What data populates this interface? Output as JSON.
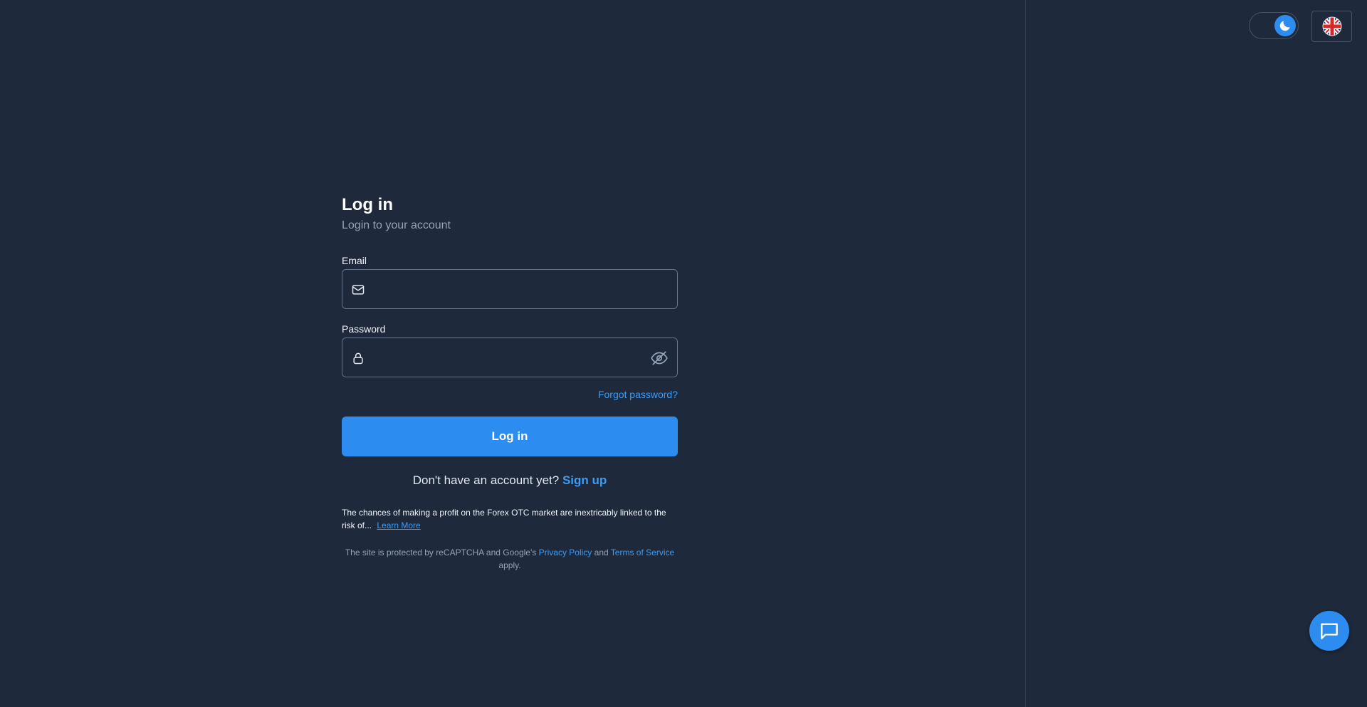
{
  "header": {
    "theme_toggle_icon": "moon-icon",
    "language_icon": "uk-flag-icon"
  },
  "login": {
    "title": "Log in",
    "subtitle": "Login to your account",
    "email_label": "Email",
    "email_value": "",
    "email_placeholder": "",
    "password_label": "Password",
    "password_value": "",
    "password_placeholder": "",
    "forgot_link": "Forgot password?",
    "submit_label": "Log in",
    "signup_prompt": "Don't have an account yet?",
    "signup_link": "Sign up",
    "risk_text": "The chances of making a profit on the Forex OTC market are inextricably linked to the risk of...",
    "risk_link": "Learn More",
    "recaptcha_prefix": "The site is protected by reCAPTCHA and Google's",
    "privacy_link": "Privacy Policy",
    "recaptcha_and": "and",
    "terms_link": "Terms of Service",
    "recaptcha_suffix": "apply."
  },
  "chat": {
    "icon": "chat-icon"
  },
  "colors": {
    "background": "#1e293b",
    "accent": "#2d8cf0",
    "link": "#3b9cf6",
    "border": "#64748b",
    "muted_text": "#94a3b8"
  }
}
